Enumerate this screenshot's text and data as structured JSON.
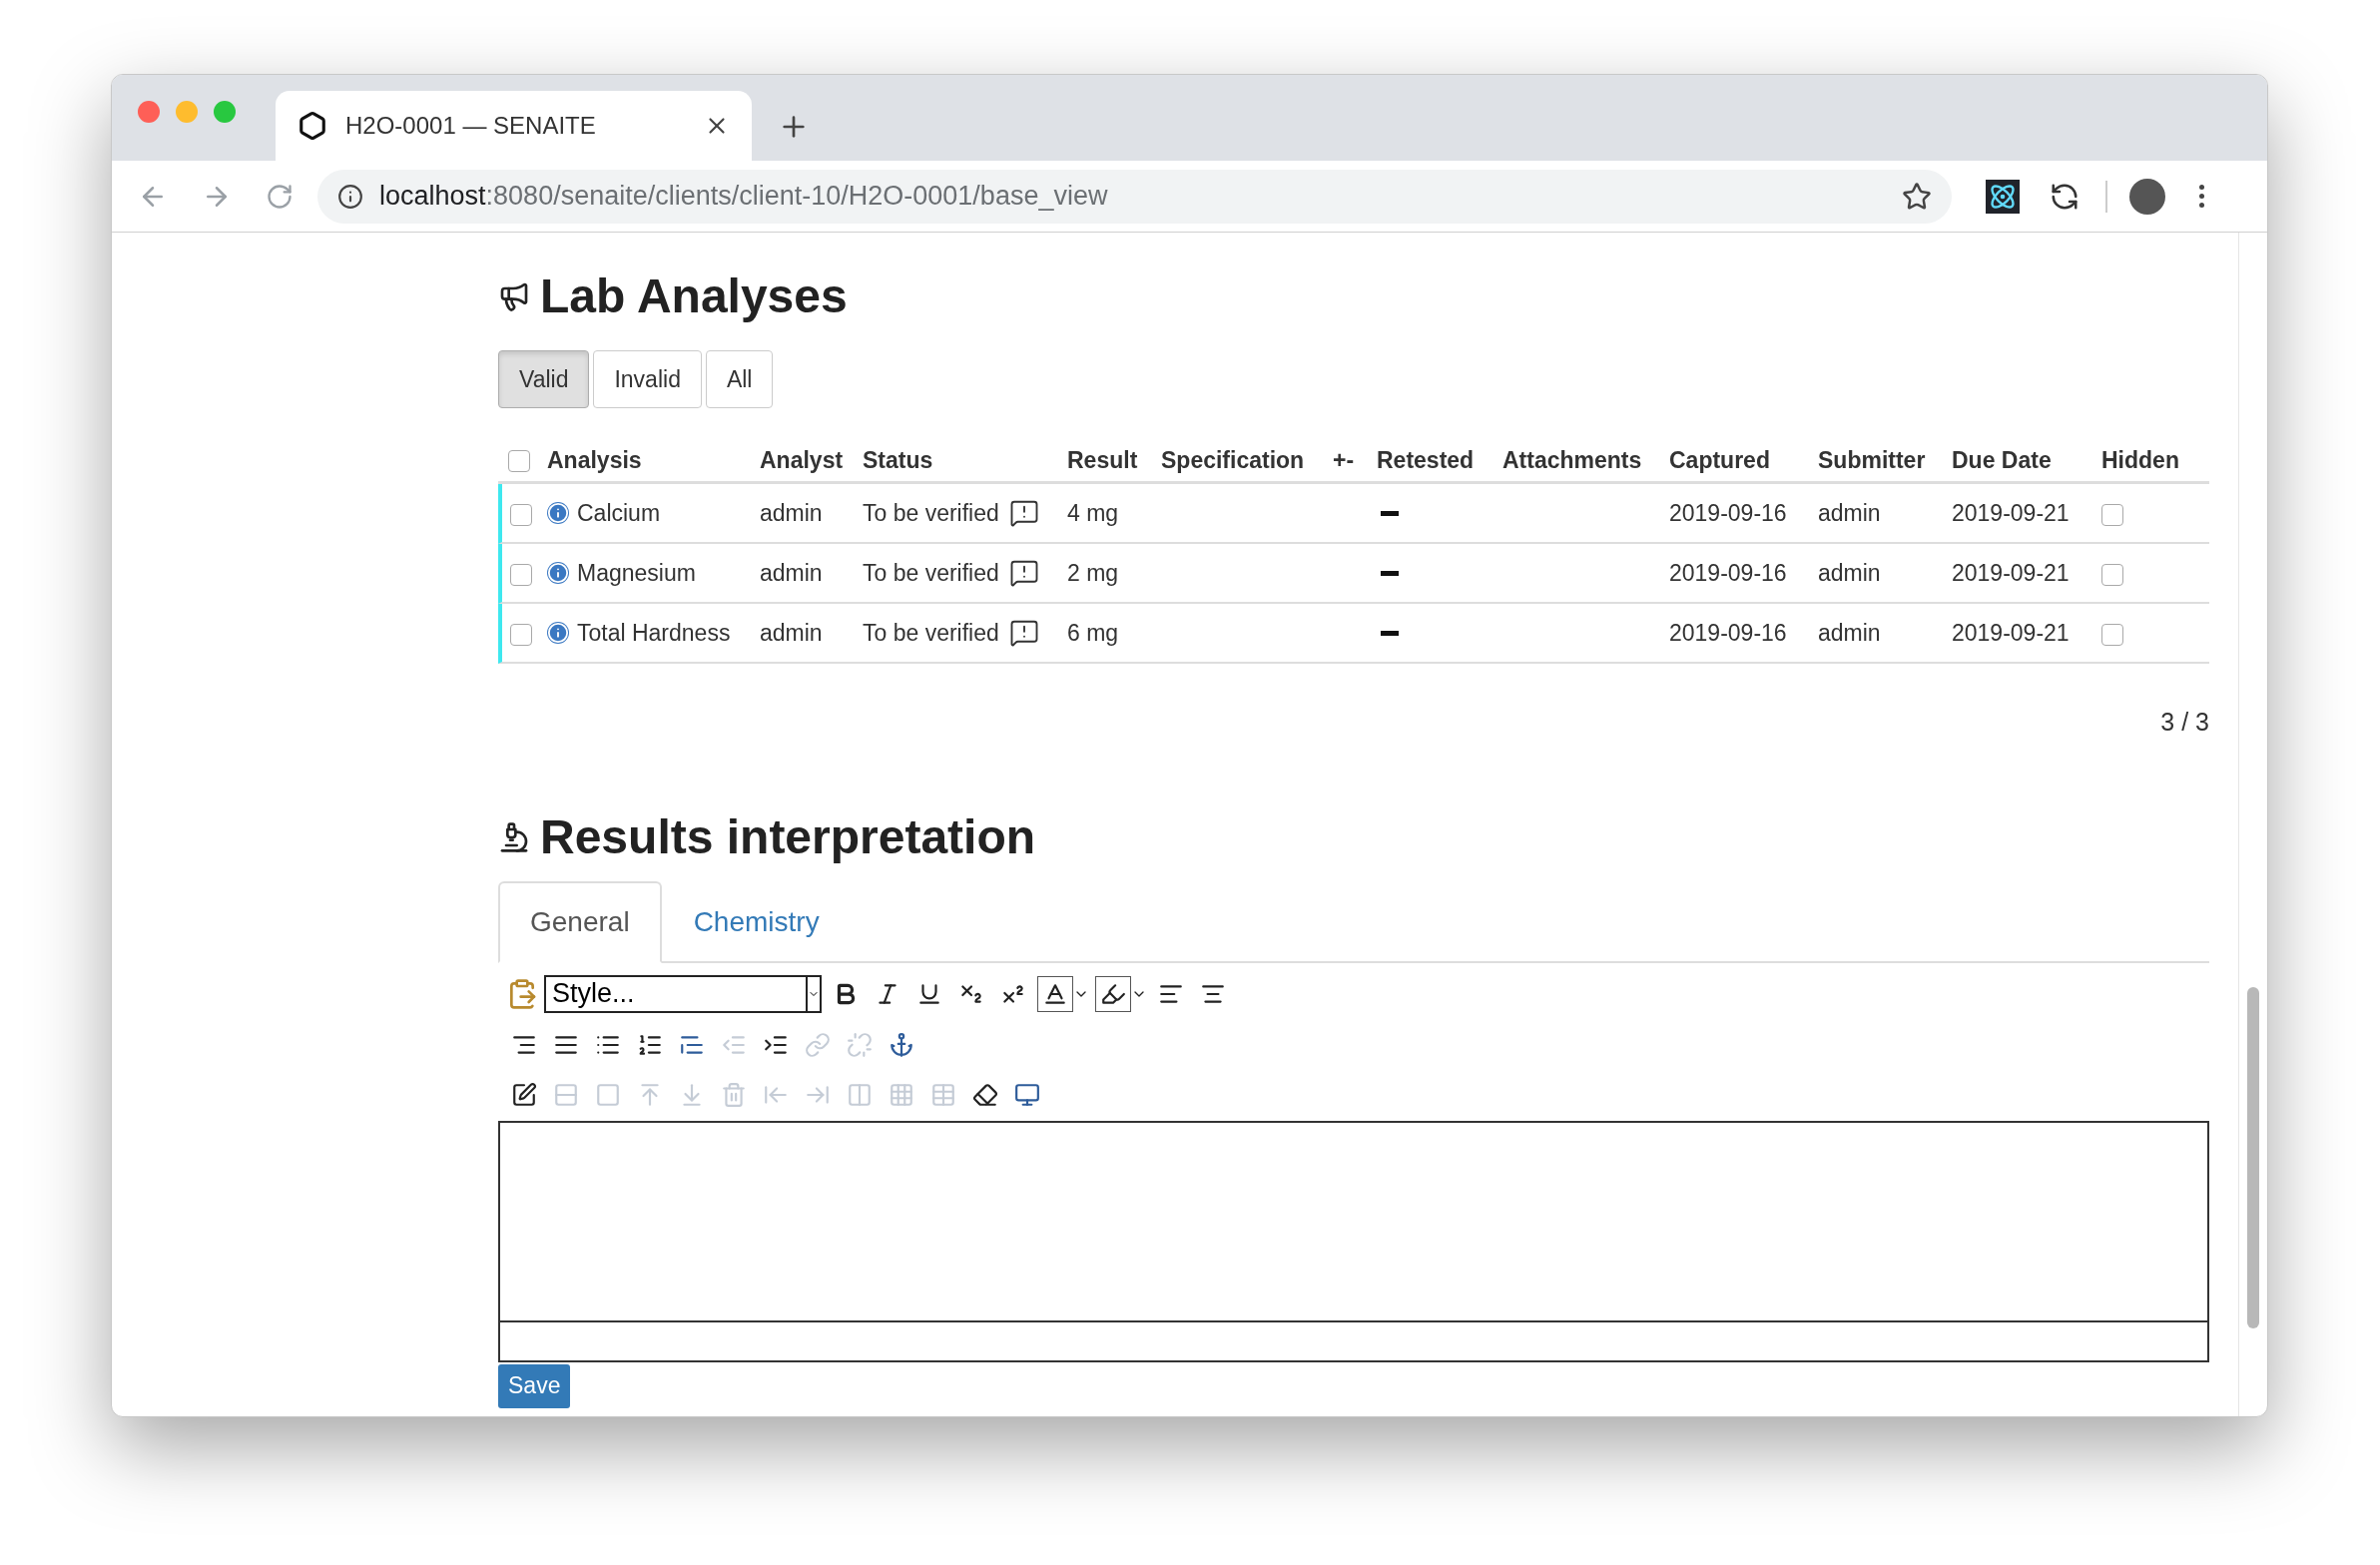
{
  "browser": {
    "tab_title": "H2O-0001 — SENAITE",
    "url_host": "localhost",
    "url_path": ":8080/senaite/clients/client-10/H2O-0001/base_view"
  },
  "lab_analyses": {
    "title": "Lab Analyses",
    "filters": [
      {
        "label": "Valid",
        "selected": true
      },
      {
        "label": "Invalid",
        "selected": false
      },
      {
        "label": "All",
        "selected": false
      }
    ],
    "table": {
      "select_all_checked": false,
      "columns": [
        "Analysis",
        "Analyst",
        "Status",
        "Result",
        "Specification",
        "+-",
        "Retested",
        "Attachments",
        "Captured",
        "Submitter",
        "Due Date",
        "Hidden"
      ],
      "rows": [
        {
          "checked": false,
          "analysis": "Calcium",
          "analyst": "admin",
          "status": "To be verified",
          "result": "4 mg",
          "captured": "2019-09-16",
          "submitter": "admin",
          "due_date": "2019-09-21",
          "hidden": false
        },
        {
          "checked": false,
          "analysis": "Magnesium",
          "analyst": "admin",
          "status": "To be verified",
          "result": "2 mg",
          "captured": "2019-09-16",
          "submitter": "admin",
          "due_date": "2019-09-21",
          "hidden": false
        },
        {
          "checked": false,
          "analysis": "Total Hardness",
          "analyst": "admin",
          "status": "To be verified",
          "result": "6 mg",
          "captured": "2019-09-16",
          "submitter": "admin",
          "due_date": "2019-09-21",
          "hidden": false
        }
      ]
    },
    "pagination": "3 / 3"
  },
  "results_interpretation": {
    "title": "Results interpretation",
    "tabs": [
      {
        "label": "General",
        "selected": true
      },
      {
        "label": "Chemistry",
        "selected": false
      }
    ],
    "editor": {
      "style_select": "Style...",
      "toolbar": [
        [
          {
            "kind": "bold",
            "disabled": false
          },
          {
            "kind": "italic",
            "disabled": false
          },
          {
            "kind": "underline",
            "disabled": false
          },
          {
            "kind": "subscript",
            "disabled": false
          },
          {
            "kind": "superscript",
            "disabled": false
          },
          {
            "kind": "textcolor",
            "disabled": false
          },
          {
            "kind": "highlight",
            "disabled": false
          },
          {
            "kind": "alignleft",
            "disabled": false
          },
          {
            "kind": "aligncenter",
            "disabled": false
          }
        ],
        [
          {
            "kind": "alignright",
            "disabled": false
          },
          {
            "kind": "justify",
            "disabled": false
          },
          {
            "kind": "bullets",
            "disabled": false
          },
          {
            "kind": "numbers",
            "disabled": false
          },
          {
            "kind": "blockquote",
            "disabled": false
          },
          {
            "kind": "outdent",
            "disabled": true
          },
          {
            "kind": "indent",
            "disabled": false
          },
          {
            "kind": "link",
            "disabled": true
          },
          {
            "kind": "unlink",
            "disabled": true
          },
          {
            "kind": "anchor",
            "disabled": false
          }
        ],
        [
          {
            "kind": "table",
            "disabled": false
          },
          {
            "kind": "rowprops",
            "disabled": true
          },
          {
            "kind": "cellprops",
            "disabled": true
          },
          {
            "kind": "rowbefore",
            "disabled": true
          },
          {
            "kind": "rowafter",
            "disabled": true
          },
          {
            "kind": "deleterow",
            "disabled": true
          },
          {
            "kind": "colbefore",
            "disabled": true
          },
          {
            "kind": "colafter",
            "disabled": true
          },
          {
            "kind": "deletecol",
            "disabled": true
          },
          {
            "kind": "splitcells",
            "disabled": true
          },
          {
            "kind": "mergecells",
            "disabled": true
          },
          {
            "kind": "eraser",
            "disabled": false
          },
          {
            "kind": "fullscreen",
            "disabled": false
          }
        ]
      ]
    },
    "save_button": "Save"
  }
}
